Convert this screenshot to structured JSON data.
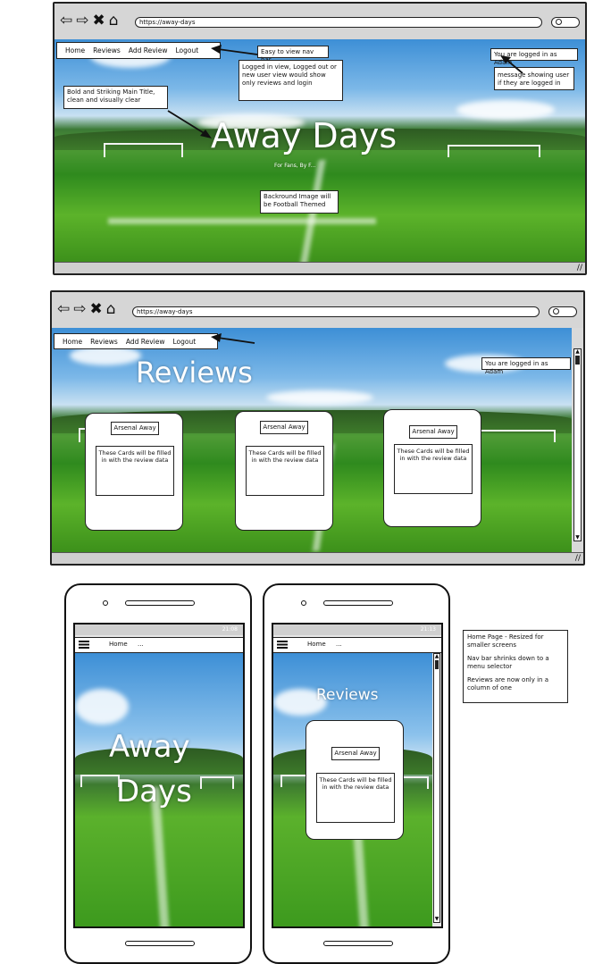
{
  "url": "https://away-days",
  "nav": {
    "home": "Home",
    "reviews": "Reviews",
    "add_review": "Add Review",
    "logout": "Logout"
  },
  "mobile_nav": {
    "home": "Home",
    "more": "..."
  },
  "hero": {
    "title": "Away Days",
    "title_line1": "Away",
    "title_line2": "Days",
    "subtitle": "For Fans, By F..."
  },
  "logged_in": "You are logged in as Adam",
  "reviews_title": "Reviews",
  "card": {
    "title": "Arsenal Away",
    "body": "These Cards will be filled in with the review data"
  },
  "phone_time_1": "21:08",
  "phone_time_2": "21:13",
  "annotations": {
    "nav_bar": "Easy to view nav bar",
    "nav_logged_in": "Logged in view, Logged out or new user view would show only reviews and login",
    "main_title": "Bold and Striking Main Title, clean and visually clear",
    "background": "Backround Image will be Football Themed",
    "user_message": "message showing user if they are logged in",
    "mobile_1": "Home Page - Resized for smaller screens",
    "mobile_2": "Nav bar shrinks down to a menu selector",
    "mobile_3": "Reviews are now only in a column of one"
  },
  "icons": {
    "back": "arrow-left-icon",
    "forward": "arrow-right-icon",
    "close": "close-icon",
    "home": "home-icon",
    "search": "search-icon",
    "menu": "hamburger-menu-icon"
  },
  "colors": {
    "sky": "#4a9be0",
    "grass": "#3f9a22",
    "ink": "#222222"
  }
}
